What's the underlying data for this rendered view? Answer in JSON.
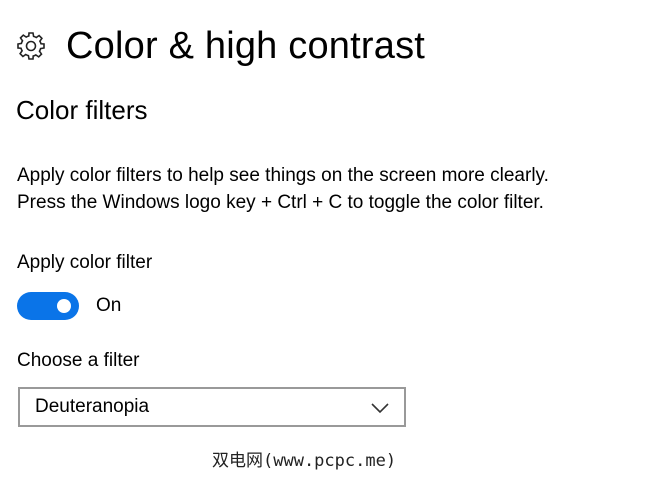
{
  "header": {
    "icon": "gear-icon",
    "title": "Color & high contrast"
  },
  "color_filters": {
    "section_title": "Color filters",
    "description_line1": "Apply color filters to help see things on the screen more clearly.",
    "description_line2": "Press the Windows logo key + Ctrl + C to toggle the color filter.",
    "apply_label": "Apply color filter",
    "toggle_state": "On",
    "toggle_on": true,
    "choose_label": "Choose a filter",
    "selected_filter": "Deuteranopia",
    "dropdown_icon": "chevron-down-icon"
  },
  "watermark": {
    "text": "双电网(www.pcpc.me)"
  },
  "colors": {
    "accent": "#0a74e8",
    "border": "#999999",
    "text": "#000000"
  }
}
